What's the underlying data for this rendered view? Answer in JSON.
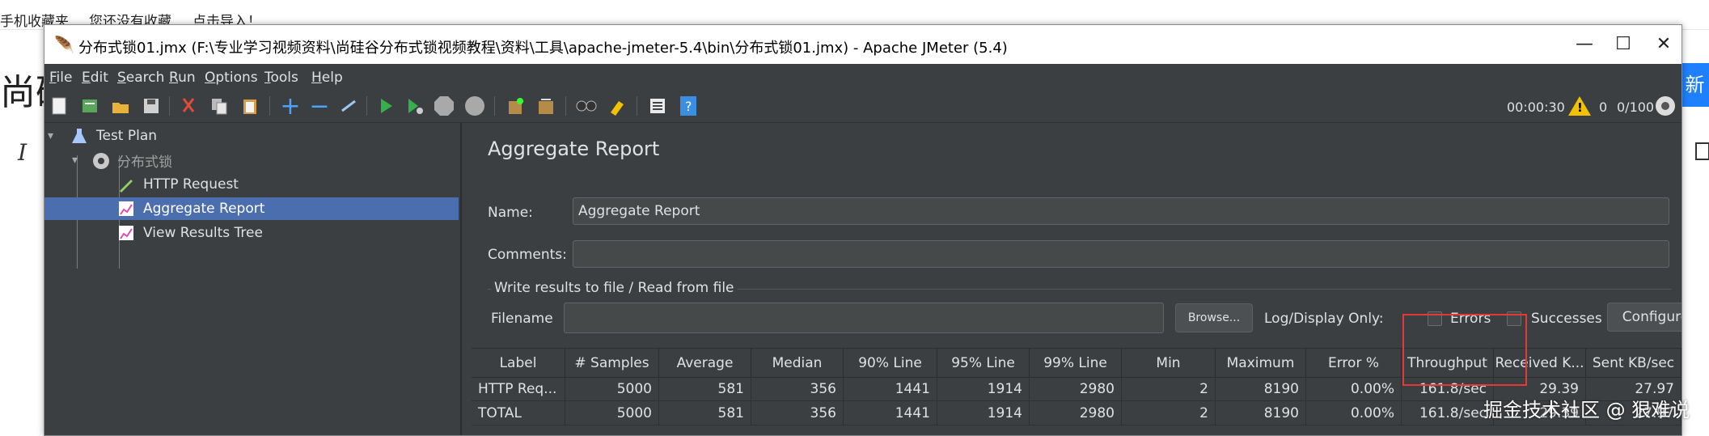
{
  "background": {
    "top_texts": [
      "手机收藏夹",
      "您还没有收藏",
      "点击导入！"
    ],
    "left_title": "尚硅",
    "italic_glyph": "I",
    "right_button_label": "新"
  },
  "window": {
    "title": "分布式锁01.jmx (F:\\专业学习视频资料\\尚硅谷分布式锁视频教程\\资料\\工具\\apache-jmeter-5.4\\bin\\分布式锁01.jmx) - Apache JMeter (5.4)",
    "controls": {
      "minimize": "—",
      "maximize": "☐",
      "close": "✕"
    }
  },
  "menu": [
    {
      "underline": "F",
      "rest": "ile"
    },
    {
      "underline": "E",
      "rest": "dit"
    },
    {
      "underline": "S",
      "rest": "earch"
    },
    {
      "underline": "R",
      "rest": "un"
    },
    {
      "underline": "O",
      "rest": "ptions"
    },
    {
      "underline": "T",
      "rest": "ools"
    },
    {
      "underline": "H",
      "rest": "elp"
    }
  ],
  "toolbar": {
    "timer": "00:00:30",
    "warnings": "0",
    "threads": "0/100"
  },
  "tree": {
    "test_plan": "Test Plan",
    "thread_group": "分布式锁",
    "http_request": "HTTP Request",
    "aggregate_report": "Aggregate Report",
    "view_results_tree": "View Results Tree"
  },
  "panel": {
    "title": "Aggregate Report",
    "name_label": "Name:",
    "name_value": "Aggregate Report",
    "comments_label": "Comments:",
    "comments_value": "",
    "group_title": "Write results to file / Read from file",
    "filename_label": "Filename",
    "filename_value": "",
    "browse_label": "Browse...",
    "log_display_label": "Log/Display Only:",
    "errors_label": "Errors",
    "successes_label": "Successes",
    "configure_label": "Configure"
  },
  "table": {
    "headers": [
      "Label",
      "# Samples",
      "Average",
      "Median",
      "90% Line",
      "95% Line",
      "99% Line",
      "Min",
      "Maximum",
      "Error %",
      "Throughput",
      "Received K...",
      "Sent KB/sec"
    ],
    "rows": [
      [
        "HTTP Req...",
        "5000",
        "581",
        "356",
        "1441",
        "1914",
        "2980",
        "2",
        "8190",
        "0.00%",
        "161.8/sec",
        "29.39",
        "27.97"
      ],
      [
        "TOTAL",
        "5000",
        "581",
        "356",
        "1441",
        "1914",
        "2980",
        "2",
        "8190",
        "0.00%",
        "161.8/sec",
        "29.39",
        "27.97"
      ]
    ]
  },
  "watermark": "掘金技术社区 @ 狠难说"
}
